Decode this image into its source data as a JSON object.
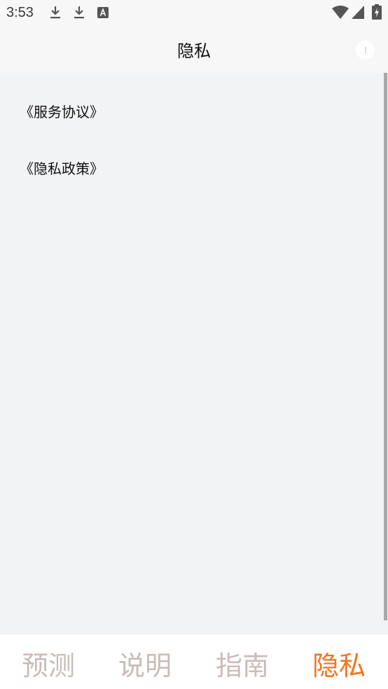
{
  "status_bar": {
    "time": "3:53",
    "icons": [
      "download-icon",
      "download-icon",
      "font-a-icon",
      "wifi-icon",
      "signal-icon",
      "battery-charging-icon"
    ]
  },
  "header": {
    "title": "隐私",
    "info_icon": "info-icon"
  },
  "links": [
    {
      "label": "《服务协议》"
    },
    {
      "label": "《隐私政策》"
    }
  ],
  "tabs": [
    {
      "label": "预测",
      "active": false
    },
    {
      "label": "说明",
      "active": false
    },
    {
      "label": "指南",
      "active": false
    },
    {
      "label": "隐私",
      "active": true
    }
  ],
  "colors": {
    "accent": "#f07521",
    "tab_inactive": "#c9bcb7",
    "content_bg": "#f2f3f5",
    "header_bg": "#f7f7f8"
  }
}
